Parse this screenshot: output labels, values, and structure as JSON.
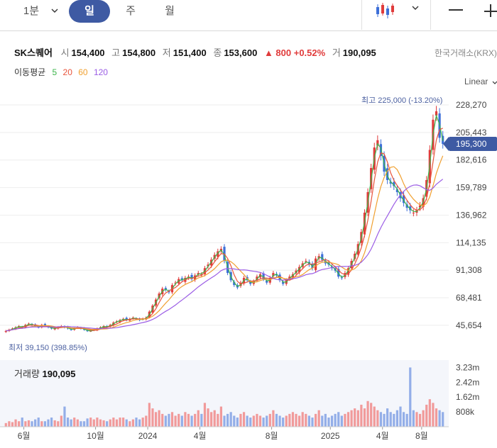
{
  "toolbar": {
    "intervals": [
      "1분",
      "일",
      "주",
      "월"
    ],
    "active_interval": "일"
  },
  "stock": {
    "name": "SK스퀘어",
    "open_label": "시",
    "open": "154,400",
    "high_label": "고",
    "high": "154,800",
    "low_label": "저",
    "low": "151,400",
    "close_label": "종",
    "close": "153,600",
    "change": "▲ 800 +0.52%",
    "volume_label": "거",
    "volume": "190,095",
    "exchange": "한국거래소(KRX)"
  },
  "moving_averages": {
    "title": "이동평균",
    "periods": [
      "5",
      "20",
      "60",
      "120"
    ],
    "colors": [
      "#3bb54a",
      "#e8543c",
      "#f0a030",
      "#9b5de5"
    ]
  },
  "scale_mode": "Linear",
  "current_price": "195,300",
  "colors": {
    "up": "#e03b3b",
    "down": "#3d6fd8",
    "accent": "#3e5aa3"
  },
  "chart_data": {
    "type": "candlestick",
    "y_ticks": [
      "228,270",
      "205,443",
      "182,616",
      "159,789",
      "136,962",
      "114,135",
      "91,308",
      "68,481",
      "45,654"
    ],
    "y_tick_values": [
      228270,
      205443,
      182616,
      159789,
      136962,
      114135,
      91308,
      68481,
      45654
    ],
    "x_ticks": [
      "6월",
      "10월",
      "2024",
      "4월",
      "8월",
      "2025",
      "4월",
      "8월"
    ],
    "annotations": {
      "high": "최고 225,000 (-13.20%)",
      "low": "최저 39,150 (398.85%)"
    },
    "close_series": [
      40,
      41,
      42,
      43,
      44,
      43,
      45,
      46,
      45,
      44,
      43,
      45,
      44,
      43,
      42,
      42,
      43,
      44,
      43,
      42,
      41,
      42,
      43,
      42,
      41,
      40,
      40,
      41,
      42,
      43,
      44,
      43,
      45,
      47,
      48,
      49,
      50,
      49,
      50,
      51,
      50,
      49,
      50,
      51,
      56,
      61,
      66,
      71,
      75,
      74,
      72,
      78,
      80,
      83,
      82,
      84,
      85,
      83,
      86,
      88,
      87,
      92,
      95,
      99,
      103,
      106,
      108,
      98,
      88,
      82,
      78,
      76,
      80,
      84,
      82,
      79,
      81,
      85,
      87,
      83,
      80,
      84,
      88,
      86,
      82,
      79,
      82,
      85,
      87,
      90,
      93,
      96,
      98,
      95,
      92,
      100,
      102,
      99,
      96,
      95,
      92,
      90,
      85,
      84,
      88,
      92,
      98,
      104,
      112,
      122,
      138,
      155,
      175,
      192,
      198,
      185,
      172,
      165,
      162,
      160,
      155,
      150,
      146,
      142,
      140,
      138,
      140,
      144,
      150,
      165,
      190,
      215,
      222,
      200,
      195
    ],
    "ma_note": "5, 20, 60, 120 day moving averages",
    "volume_ticks": [
      "3.23m",
      "2.42m",
      "1.62m",
      "808k"
    ],
    "volume_tick_values": [
      3230000,
      2420000,
      1620000,
      808000
    ],
    "volume_series": [
      0.2,
      0.3,
      0.25,
      0.4,
      0.3,
      0.5,
      0.3,
      0.35,
      0.3,
      0.4,
      0.5,
      0.3,
      0.3,
      0.4,
      0.5,
      0.35,
      0.3,
      0.6,
      1.1,
      0.5,
      0.4,
      0.5,
      0.4,
      0.3,
      0.3,
      0.45,
      0.5,
      0.4,
      0.5,
      0.4,
      0.35,
      0.3,
      0.4,
      0.5,
      0.4,
      0.5,
      0.5,
      0.4,
      0.3,
      0.4,
      0.5,
      0.4,
      0.5,
      0.6,
      1.3,
      1.0,
      0.8,
      0.9,
      0.7,
      0.6,
      0.7,
      0.8,
      0.6,
      0.7,
      0.6,
      0.8,
      0.7,
      0.6,
      0.7,
      0.9,
      0.7,
      1.3,
      1.0,
      0.8,
      0.9,
      0.7,
      1.1,
      0.6,
      0.7,
      0.8,
      0.6,
      0.5,
      0.7,
      0.8,
      0.6,
      0.5,
      0.6,
      0.7,
      0.6,
      0.5,
      0.6,
      0.7,
      0.9,
      0.7,
      0.6,
      0.5,
      0.6,
      0.7,
      0.8,
      0.7,
      0.6,
      0.8,
      0.7,
      0.6,
      0.5,
      0.7,
      0.9,
      0.6,
      0.7,
      0.5,
      0.6,
      0.7,
      0.8,
      0.6,
      0.7,
      0.8,
      0.9,
      1.0,
      0.9,
      1.2,
      1.0,
      1.4,
      1.3,
      1.1,
      0.9,
      0.8,
      0.7,
      1.0,
      0.8,
      0.7,
      0.9,
      1.1,
      0.8,
      0.7,
      3.23,
      0.9,
      0.8,
      0.7,
      0.9,
      1.2,
      1.5,
      1.3,
      1.0,
      0.9,
      0.8
    ]
  }
}
